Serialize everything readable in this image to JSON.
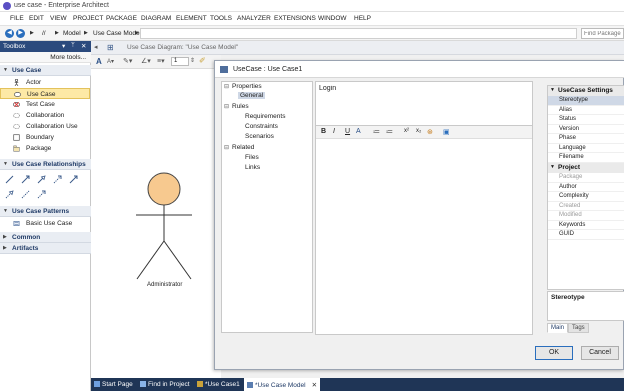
{
  "window": {
    "title": "use case - Enterprise Architect"
  },
  "menu": [
    "FILE",
    "EDIT",
    "VIEW",
    "PROJECT",
    "PACKAGE",
    "DIAGRAM",
    "ELEMENT",
    "TOOLS",
    "ANALYZER",
    "EXTENSIONS",
    "WINDOW",
    "HELP"
  ],
  "address": {
    "root": "//",
    "crumbs": [
      "Model",
      "Use Case Model"
    ],
    "find_placeholder": "Find Package"
  },
  "toolbox": {
    "title": "Toolbox",
    "more_tools": "More tools...",
    "sections": {
      "use_case": "Use Case",
      "relationships": "Use Case Relationships",
      "patterns": "Use Case Patterns",
      "common": "Common",
      "artifacts": "Artifacts"
    },
    "items": [
      "Actor",
      "Use Case",
      "Test Case",
      "Collaboration",
      "Collaboration Use",
      "Boundary",
      "Package"
    ],
    "pattern_items": [
      "Basic Use Case"
    ]
  },
  "diagram": {
    "title": "Use Case Diagram: \"Use Case Model\"",
    "zoom_field": "1",
    "actor_label": "Administrator"
  },
  "dialog": {
    "title": "UseCase : Use Case1",
    "tree": {
      "properties": "Properties",
      "general": "General",
      "rules": "Rules",
      "requirements": "Requirements",
      "constraints": "Constraints",
      "scenarios": "Scenarios",
      "related": "Related",
      "files": "Files",
      "links": "Links"
    },
    "name_value": "Login",
    "notes_toolbar": [
      "B",
      "I",
      "U",
      "A",
      "≔",
      "≔",
      "x²",
      "x₂"
    ],
    "settings": {
      "section1": "UseCase Settings",
      "rows1": [
        "Stereotype",
        "Alias",
        "Status",
        "Version",
        "Phase",
        "Language",
        "Filename"
      ],
      "section2": "Project",
      "rows2": [
        "Package",
        "Author",
        "Complexity",
        "Created",
        "Modified",
        "Keywords",
        "GUID"
      ]
    },
    "description_label": "Stereotype",
    "tabs": [
      "Main",
      "Tags"
    ],
    "ok": "OK",
    "cancel": "Cancel"
  },
  "bottom_tabs": [
    "Start Page",
    "Find in Project",
    "*Use Case1",
    "*Use Case Model"
  ],
  "colors": {
    "toolbox_header": "#2b4a7d",
    "selected_item": "#fde9a6",
    "actor_head": "#f7c98f",
    "accent": "#2a6ebd"
  }
}
